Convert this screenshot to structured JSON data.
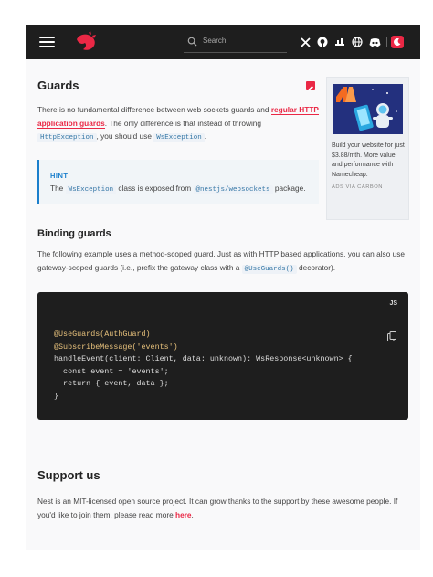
{
  "header": {
    "search_placeholder": "Search",
    "icons": [
      "menu-icon",
      "nestjs-logo",
      "search-icon",
      "x-icon",
      "github-icon",
      "stackshare-icon",
      "language-icon",
      "discord-icon",
      "theme-icon"
    ]
  },
  "content": {
    "title": "Guards",
    "intro": {
      "part1": "There is no fundamental difference between web sockets guards and ",
      "link": "regular HTTP application guards",
      "part2": ". The only difference is that instead of throwing ",
      "code1": "HttpException",
      "part3": ", you should use ",
      "code2": "WsException",
      "part4": "."
    },
    "hint": {
      "label": "HINT",
      "pre": "The ",
      "code1": "WsException",
      "mid": " class is exposed from ",
      "code2": "@nestjs/websockets",
      "post": " package."
    },
    "binding": {
      "heading": "Binding guards",
      "pre": "The following example uses a method-scoped guard. Just as with HTTP based applications, you can also use gateway-scoped guards (i.e., prefix the gateway class with a ",
      "code": "@UseGuards()",
      "post": " decorator)."
    },
    "code_block": {
      "lang": "JS",
      "lines": [
        "@UseGuards(AuthGuard)",
        "@SubscribeMessage('events')",
        "handleEvent(client: Client, data: unknown): WsResponse<unknown> {",
        "  const event = 'events';",
        "  return { event, data };",
        "}"
      ]
    },
    "support": {
      "heading": "Support us",
      "text": "Nest is an MIT-licensed open source project. It can grow thanks to the support by these awesome people. If you'd like to join them, please read more ",
      "link": "here",
      "post": "."
    }
  },
  "ad": {
    "text": "Build your website for just $3.88/mth. More value and performance with Namecheap.",
    "via": "ADS VIA CARBON"
  },
  "colors": {
    "brand": "#ea2845",
    "topbar": "#1e1e1e",
    "hint_accent": "#1b7fcc",
    "code_bg": "#1e1e1e"
  }
}
